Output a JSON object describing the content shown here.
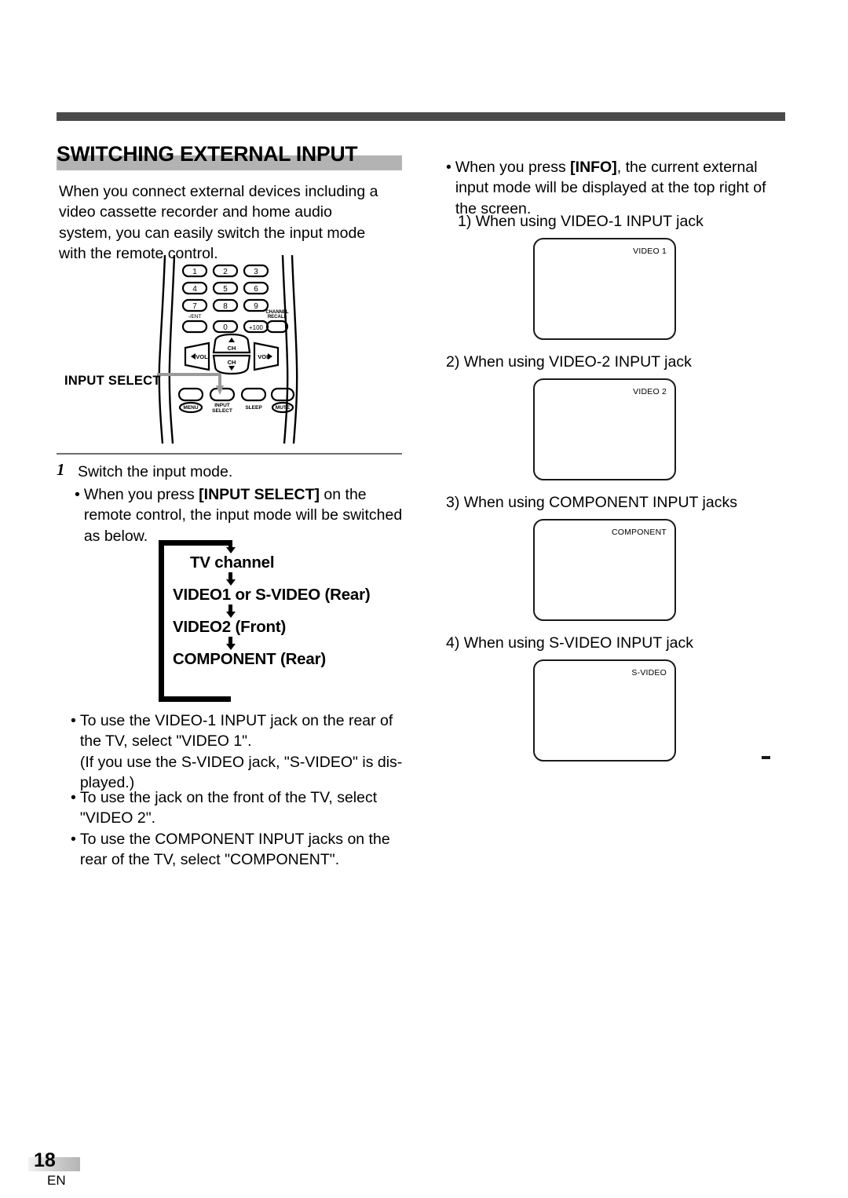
{
  "page": {
    "number": "18",
    "language_code": "EN"
  },
  "section": {
    "title": "SWITCHING EXTERNAL INPUT",
    "intro": "When you connect external devices including a video cassette recorder and home audio system, you can easily switch the input mode with the remote control."
  },
  "remote": {
    "callout_label": "INPUT SELECT",
    "keys": {
      "row1": [
        "1",
        "2",
        "3"
      ],
      "row2": [
        "4",
        "5",
        "6"
      ],
      "row3": [
        "7",
        "8",
        "9"
      ],
      "row4_ent_label": "-/ENT",
      "row4": [
        "",
        "0",
        "+100"
      ],
      "channel_recall_line1": "CHANNEL",
      "channel_recall_line2": "RECALL",
      "vol_down": "VOL",
      "vol_up": "VOL",
      "ch_up": "CH",
      "ch_down": "CH",
      "bottom": [
        "MENU",
        "INPUT SELECT",
        "SLEEP",
        "MUTE"
      ],
      "input_select_line1": "INPUT",
      "input_select_line2": "SELECT",
      "sleep": "SLEEP",
      "menu": "MENU",
      "mute": "MUTE"
    }
  },
  "step1": {
    "number": "1",
    "title": "Switch the input mode.",
    "bullet_prefix": "When you press ",
    "bullet_bold": "[INPUT SELECT]",
    "bullet_suffix": " on the remote control, the input mode will be switched as below."
  },
  "flow": {
    "items": [
      "TV channel",
      "VIDEO1 or S-VIDEO (Rear)",
      "VIDEO2 (Front)",
      "COMPONENT (Rear)"
    ]
  },
  "left_bullets": [
    "To use the VIDEO-1 INPUT jack on the rear of the TV, select \"VIDEO 1\".\n(If you use the S-VIDEO jack, \"S-VIDEO\" is dis-played.)",
    "To use the jack on the front of the TV, select \"VIDEO 2\".",
    "To use the COMPONENT INPUT jacks on the rear of the TV, select \"COMPONENT\"."
  ],
  "left_bullet_texts": {
    "video1": "To use the VIDEO-1 INPUT jack on the rear of the TV, select \"VIDEO 1\".",
    "video1_note": "(If you use the S-VIDEO jack, \"S-VIDEO\" is dis-",
    "video1_note2": "played.)",
    "video2": "To use the jack on the front of the TV, select \"VIDEO 2\".",
    "component": "To use the COMPONENT INPUT jacks on the rear of the TV, select \"COMPONENT\"."
  },
  "right_column": {
    "info_prefix": "When you press ",
    "info_bold": "[INFO]",
    "info_suffix": ", the current external input mode will be displayed at the top right of the screen.",
    "items": [
      {
        "label": "1) When using VIDEO-1 INPUT jack",
        "screen_label": "VIDEO 1"
      },
      {
        "label": "2) When using VIDEO-2 INPUT jack",
        "screen_label": "VIDEO 2"
      },
      {
        "label": "3) When using COMPONENT INPUT jacks",
        "screen_label": "COMPONENT"
      },
      {
        "label": "4) When using S-VIDEO INPUT jack",
        "screen_label": "S-VIDEO"
      }
    ]
  },
  "colors": {
    "top_bar": "#4a4a4a",
    "title_band": "#b3b3b3",
    "divider": "#6e6e6e",
    "ink": "#000000"
  }
}
